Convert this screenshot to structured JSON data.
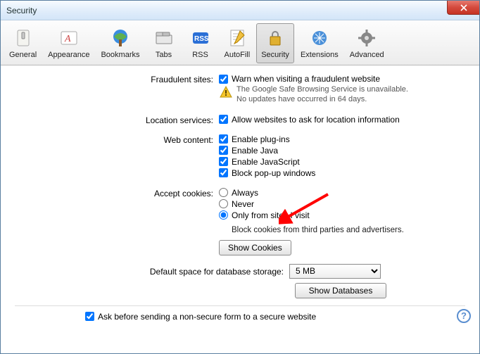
{
  "window": {
    "title": "Security"
  },
  "toolbar": [
    {
      "id": "general",
      "label": "General",
      "active": false
    },
    {
      "id": "appearance",
      "label": "Appearance",
      "active": false
    },
    {
      "id": "bookmarks",
      "label": "Bookmarks",
      "active": false
    },
    {
      "id": "tabs",
      "label": "Tabs",
      "active": false
    },
    {
      "id": "rss",
      "label": "RSS",
      "active": false
    },
    {
      "id": "autofill",
      "label": "AutoFill",
      "active": false
    },
    {
      "id": "security",
      "label": "Security",
      "active": true
    },
    {
      "id": "extensions",
      "label": "Extensions",
      "active": false
    },
    {
      "id": "advanced",
      "label": "Advanced",
      "active": false
    }
  ],
  "sections": {
    "fraud": {
      "label": "Fraudulent sites:",
      "checkbox": {
        "checked": true,
        "text": "Warn when visiting a fraudulent website"
      },
      "warning_line1": "The Google Safe Browsing Service is unavailable.",
      "warning_line2": "No updates have occurred in 64 days."
    },
    "location": {
      "label": "Location services:",
      "checkbox": {
        "checked": true,
        "text": "Allow websites to ask for location information"
      }
    },
    "webcontent": {
      "label": "Web content:",
      "items": [
        {
          "checked": true,
          "text": "Enable plug-ins"
        },
        {
          "checked": true,
          "text": "Enable Java"
        },
        {
          "checked": true,
          "text": "Enable JavaScript"
        },
        {
          "checked": true,
          "text": "Block pop-up windows"
        }
      ]
    },
    "cookies": {
      "label": "Accept cookies:",
      "options": [
        {
          "text": "Always",
          "selected": false
        },
        {
          "text": "Never",
          "selected": false
        },
        {
          "text": "Only from sites I visit",
          "selected": true
        }
      ],
      "subtext": "Block cookies from third parties and advertisers.",
      "show_button": "Show Cookies"
    },
    "database": {
      "label": "Default space for database storage:",
      "selected": "5 MB",
      "show_button": "Show Databases"
    },
    "nonsecure": {
      "checked": true,
      "text": "Ask before sending a non-secure form to a secure website"
    }
  },
  "annotation": {
    "arrow_color": "#ff0000"
  }
}
